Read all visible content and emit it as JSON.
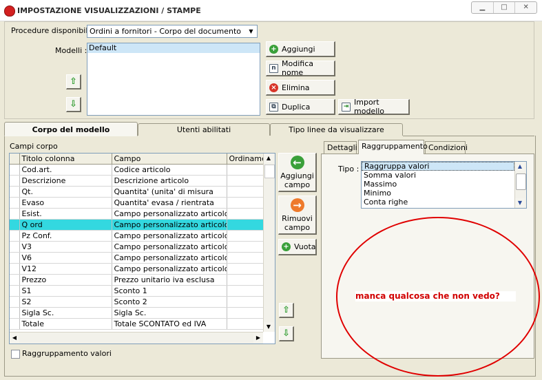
{
  "window": {
    "title": "IMPOSTAZIONE VISUALIZZAZIONI / STAMPE",
    "min_glyph": "▁",
    "max_glyph": "□",
    "close_glyph": "✕"
  },
  "procedure": {
    "label": "Procedure disponibili :",
    "value": "Ordini a fornitori - Corpo del documento"
  },
  "modelli": {
    "label": "Modelli :",
    "items": [
      "Default"
    ]
  },
  "buttons": {
    "aggiungi": "Aggiungi",
    "modifica_nome": "Modifica nome",
    "elimina": "Elimina",
    "duplica": "Duplica",
    "import_modello": "Import modello"
  },
  "main_tabs": [
    "Corpo del modello",
    "Utenti abilitati",
    "Tipo linee da visualizzare"
  ],
  "campi": {
    "label": "Campi corpo",
    "columns": [
      "Titolo colonna",
      "Campo",
      "Ordinamen"
    ],
    "rows": [
      [
        "Cod.art.",
        "Codice articolo"
      ],
      [
        "Descrizione",
        "Descrizione articolo"
      ],
      [
        "Qt.",
        "Quantita' (unita' di misura"
      ],
      [
        "Evaso",
        "Quantita' evasa / rientrata"
      ],
      [
        "Esist.",
        "Campo personalizzato articolo"
      ],
      [
        "Q ord",
        "Campo personalizzato articolo"
      ],
      [
        "Pz Conf.",
        "Campo personalizzato articolo"
      ],
      [
        "V3",
        "Campo personalizzato articolo"
      ],
      [
        "V6",
        "Campo personalizzato articolo"
      ],
      [
        "V12",
        "Campo personalizzato articolo"
      ],
      [
        "Prezzo",
        "Prezzo unitario iva esclusa"
      ],
      [
        "S1",
        "Sconto 1"
      ],
      [
        "S2",
        "Sconto 2"
      ],
      [
        "Sigla Sc.",
        "Sigla Sc."
      ],
      [
        "Totale",
        "Totale SCONTATO ed IVA"
      ]
    ],
    "highlight_row_label": "Q ord"
  },
  "side_buttons": {
    "aggiungi_campo_1": "Aggiungi",
    "aggiungi_campo_2": "campo",
    "rimuovi_campo_1": "Rimuovi",
    "rimuovi_campo_2": "campo",
    "vuota": "Vuota"
  },
  "raggruppamento_checkbox": "Raggruppamento valori",
  "detail_tabs": [
    "Dettagli",
    "Raggruppamento",
    "Condizioni"
  ],
  "tipo": {
    "label": "Tipo :",
    "options": [
      "Raggruppa valori",
      "Somma valori",
      "Massimo",
      "Minimo",
      "Conta righe"
    ],
    "selected": "Raggruppa valori"
  },
  "annotation": "manca qualcosa che non vedo?",
  "colors": {
    "highlight_row": "#33d8e0",
    "annotation_red": "#e00000",
    "accent_green": "#3aa03a"
  }
}
